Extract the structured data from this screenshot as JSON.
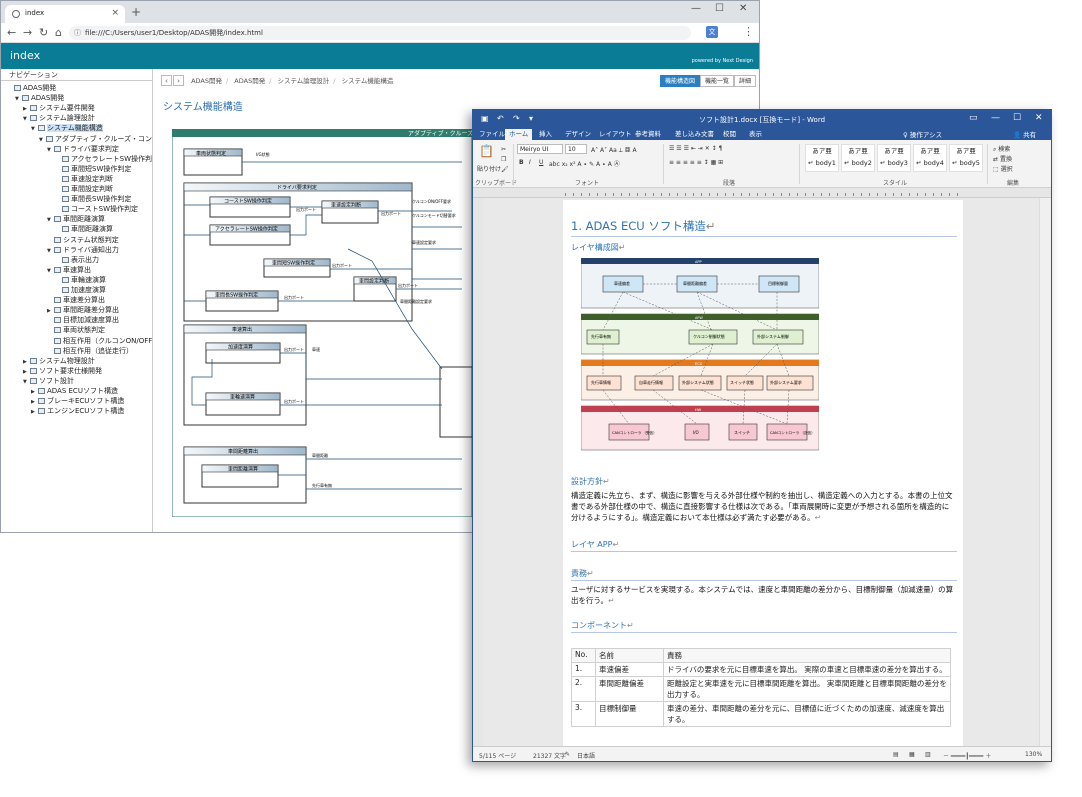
{
  "browser": {
    "tab_title": "index",
    "url": "file:///C:/Users/user1/Desktop/ADAS開発/index.html",
    "app_title": "index",
    "powered_by": "powered by Next Design",
    "nav": {
      "heading": "ナビゲーション",
      "items": [
        {
          "label": "ADAS開発",
          "depth": 0,
          "toggle": ""
        },
        {
          "label": "ADAS開発",
          "depth": 1,
          "toggle": "▼"
        },
        {
          "label": "システム要件開発",
          "depth": 2,
          "toggle": "▶"
        },
        {
          "label": "システム論理設計",
          "depth": 2,
          "toggle": "▼"
        },
        {
          "label": "システム機能構造",
          "depth": 3,
          "toggle": "▼",
          "selected": true
        },
        {
          "label": "アダプティブ・クルーズ・コント",
          "depth": 4,
          "toggle": "▼"
        },
        {
          "label": "ドライバ要求判定",
          "depth": 5,
          "toggle": "▼"
        },
        {
          "label": "アクセラレートSW操作判定",
          "depth": 6,
          "toggle": ""
        },
        {
          "label": "車間短SW操作判定",
          "depth": 6,
          "toggle": ""
        },
        {
          "label": "車速設定判断",
          "depth": 6,
          "toggle": ""
        },
        {
          "label": "車間設定判断",
          "depth": 6,
          "toggle": ""
        },
        {
          "label": "車間長SW操作判定",
          "depth": 6,
          "toggle": ""
        },
        {
          "label": "コーストSW操作判定",
          "depth": 6,
          "toggle": ""
        },
        {
          "label": "車間距離演算",
          "depth": 5,
          "toggle": "▼"
        },
        {
          "label": "車間距離演算",
          "depth": 6,
          "toggle": ""
        },
        {
          "label": "システム状態判定",
          "depth": 5,
          "toggle": ""
        },
        {
          "label": "ドライバ通知出力",
          "depth": 5,
          "toggle": "▼"
        },
        {
          "label": "表示出力",
          "depth": 6,
          "toggle": ""
        },
        {
          "label": "車速算出",
          "depth": 5,
          "toggle": "▼"
        },
        {
          "label": "車輪速演算",
          "depth": 6,
          "toggle": ""
        },
        {
          "label": "加速度演算",
          "depth": 6,
          "toggle": ""
        },
        {
          "label": "車速差分算出",
          "depth": 5,
          "toggle": ""
        },
        {
          "label": "車間距離差分算出",
          "depth": 5,
          "toggle": "▶"
        },
        {
          "label": "目標加減速度算出",
          "depth": 5,
          "toggle": ""
        },
        {
          "label": "車両状態判定",
          "depth": 5,
          "toggle": ""
        },
        {
          "label": "相互作用（クルコンON/OFF",
          "depth": 5,
          "toggle": ""
        },
        {
          "label": "相互作用（追従走行）",
          "depth": 5,
          "toggle": ""
        },
        {
          "label": "システム物理設計",
          "depth": 2,
          "toggle": "▶"
        },
        {
          "label": "ソフト要求仕様開発",
          "depth": 2,
          "toggle": "▶"
        },
        {
          "label": "ソフト設計",
          "depth": 2,
          "toggle": "▼"
        },
        {
          "label": "ADAS ECUソフト構造",
          "depth": 3,
          "toggle": "▶"
        },
        {
          "label": "ブレーキECUソフト構造",
          "depth": 3,
          "toggle": "▶"
        },
        {
          "label": "エンジンECUソフト構造",
          "depth": 3,
          "toggle": "▶"
        }
      ]
    },
    "breadcrumbs": [
      "ADAS開発",
      "ADAS開発",
      "システム論理設計",
      "システム機能構造"
    ],
    "buttons": {
      "structure": "機能構造図",
      "list": "機能一覧",
      "detail": "詳細"
    },
    "page_title": "システム機能構造",
    "diagram": {
      "title": "アダプティブ・クルーズ・",
      "blocks": {
        "vehicle_state": "車両状態判定",
        "driver_req": "ドライバ要求判定",
        "coast": "コーストSW操作判定",
        "accel": "アクセラレートSW操作判定",
        "speed_set": "車速設定判断",
        "gap_short": "車間短SW操作判定",
        "gap_set": "車間設定判断",
        "gap_long": "車間長SW操作判定",
        "speed_calc": "車速算出",
        "acc_calc": "加速度演算",
        "wheel_calc": "車輪速演算",
        "dist": "車間距離算出",
        "dist_calc": "車間距離演算"
      },
      "labels": {
        "ig": "I/G状態",
        "out_port": "出力ポート",
        "cc_onoff": "クルコンON/OFF要求",
        "cc_mode": "クルコンモード切替要求",
        "speed_req": "車速設定要求",
        "gap_req": "車間距離設定要求",
        "speed": "車速",
        "dist": "車間距離",
        "prec": "先行車有無"
      }
    }
  },
  "word": {
    "title": "ソフト設計1.docx [互換モード] - Word",
    "tabs": [
      "ファイル",
      "ホーム",
      "挿入",
      "デザイン",
      "レイアウト",
      "参考資料",
      "差し込み文書",
      "校閲",
      "表示"
    ],
    "active_tab": "ホーム",
    "tell_me": "操作アシス",
    "share": "共有",
    "ribbon": {
      "font_name": "Meiryo UI",
      "font_size": "10",
      "paste": "貼り付け",
      "groups": [
        "クリップボード",
        "フォント",
        "段落",
        "スタイル",
        "編集"
      ],
      "styles": [
        {
          "sample": "あア亜",
          "name": "↵ body1"
        },
        {
          "sample": "あア亜",
          "name": "↵ body2"
        },
        {
          "sample": "あア亜",
          "name": "↵ body3"
        },
        {
          "sample": "あア亜",
          "name": "↵ body4"
        },
        {
          "sample": "あア亜",
          "name": "↵ body5"
        }
      ],
      "edit": [
        "検索",
        "置換",
        "選択"
      ]
    },
    "doc": {
      "h1": "1.  ADAS ECU ソフト構造",
      "layer_heading": "レイヤ構成図",
      "policy_heading": "設計方針",
      "policy_text": "構造定義に先立ち、まず、構造に影響を与える外部仕様や制約を抽出し、構造定義への入力とする。本書の上位文書である外部仕様の中で、構造に直接影響する仕様は次である。「車両展開時に変更が予想される箇所を構造的に分けるようにする」。構造定義において本仕様は必ず満たす必要がある。",
      "layer_app": "レイヤ APP",
      "resp_heading": "責務",
      "resp_text": "ユーザに対するサービスを実現する。本システムでは、速度と車間距離の差分から、目標制御量（加減速量）の算出を行う。",
      "comp_heading": "コンポーネント",
      "table_header": [
        "No.",
        "名前",
        "責務"
      ],
      "table_rows": [
        {
          "no": "1.",
          "name": "車速偏差",
          "resp": "ドライバの要求を元に目標車速を算出。 実際の車速と目標車速の差分を算出する。"
        },
        {
          "no": "2.",
          "name": "車間距離偏差",
          "resp": "距離設定と実車速を元に目標車間距離を算出。 実車間距離と目標車間距離の差分を出力する。"
        },
        {
          "no": "3.",
          "name": "目標制御量",
          "resp": "車速の差分、車間距離の差分を元に、目標値に近づくための加速度、減速度を算出する。"
        }
      ],
      "figure": {
        "layers": [
          "APP",
          "AFW",
          "ECU",
          "HW"
        ],
        "app": [
          "車速偏差",
          "車間距離偏差",
          "目標制御量"
        ],
        "afw": [
          "先行車有無",
          "クルコン制御状態",
          "外部システム制御"
        ],
        "ecu": [
          "先行車情報",
          "自車走行情報",
          "外部システム状態",
          "スイッチ状態",
          "外部システム要求"
        ],
        "hw": [
          "CANコントローラ\n（受信）",
          "I/O",
          "スイッチ",
          "CANコントローラ\n（送信）"
        ]
      }
    },
    "status": {
      "page": "5/115 ページ",
      "words": "21327 文字",
      "lang": "日本語",
      "zoom": "130%"
    }
  }
}
